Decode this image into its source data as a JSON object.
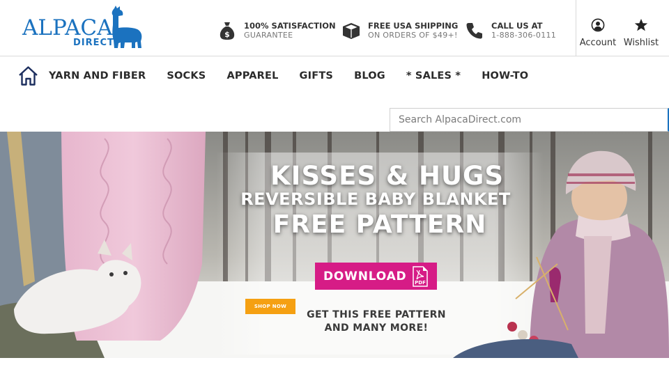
{
  "header": {
    "logo": {
      "word": "ALPACA",
      "sub": "DIRECT"
    },
    "promos": [
      {
        "icon": "money-bag-icon",
        "title": "100% SATISFACTION",
        "subtitle": "GUARANTEE"
      },
      {
        "icon": "box-icon",
        "title": "FREE USA SHIPPING",
        "subtitle": "ON ORDERS OF $49+!"
      },
      {
        "icon": "phone-icon",
        "title": "CALL US AT",
        "subtitle": "1-888-306-0111"
      }
    ],
    "account_label": "Account",
    "wishlist_label": "Wishlist"
  },
  "nav": {
    "home_icon": "home-icon",
    "items": [
      "YARN AND FIBER",
      "SOCKS",
      "APPAREL",
      "GIFTS",
      "BLOG",
      "* SALES *",
      "HOW-TO"
    ]
  },
  "search": {
    "placeholder": "Search AlpacaDirect.com",
    "value": ""
  },
  "hero": {
    "title": "KISSES & HUGS",
    "subtitle": "REVERSIBLE BABY BLANKET",
    "tagline": "FREE PATTERN",
    "download_label": "DOWNLOAD",
    "pdf_label": "PDF",
    "shop_label": "SHOP NOW",
    "note_line1": "GET THIS FREE PATTERN",
    "note_line2": "AND MANY MORE!"
  },
  "colors": {
    "brand_blue": "#1b72bf",
    "accent_pink": "#d61c86",
    "accent_orange": "#f5a012"
  }
}
